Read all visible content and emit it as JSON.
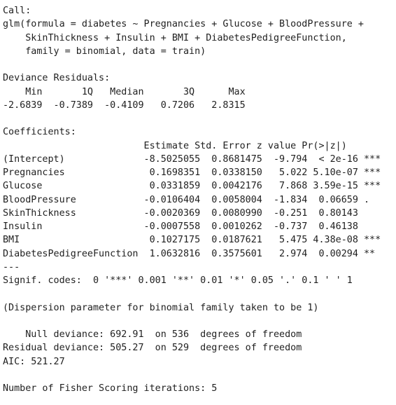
{
  "call": {
    "header": "Call:",
    "lines": [
      "glm(formula = diabetes ~ Pregnancies + Glucose + BloodPressure +",
      "    SkinThickness + Insulin + BMI + DiabetesPedigreeFunction,",
      "    family = binomial, data = train)"
    ]
  },
  "deviance_residuals": {
    "header": "Deviance Residuals:",
    "labels_line": "    Min       1Q   Median       3Q      Max  ",
    "values_line": "-2.6839  -0.7389  -0.4109   0.7206   2.8315  "
  },
  "coefficients": {
    "header": "Coefficients:",
    "column_header_line": "                         Estimate Std. Error z value Pr(>|z|)    ",
    "rows": [
      "(Intercept)              -8.5025055  0.8681475  -9.794  < 2e-16 ***",
      "Pregnancies               0.1698351  0.0338150   5.022 5.10e-07 ***",
      "Glucose                   0.0331859  0.0042176   7.868 3.59e-15 ***",
      "BloodPressure            -0.0106404  0.0058004  -1.834  0.06659 .  ",
      "SkinThickness            -0.0020369  0.0080990  -0.251  0.80143    ",
      "Insulin                  -0.0007558  0.0010262  -0.737  0.46138    ",
      "BMI                       0.1027175  0.0187621   5.475 4.38e-08 ***",
      "DiabetesPedigreeFunction  1.0632816  0.3575601   2.974  0.00294 ** "
    ],
    "separator": "---",
    "signif_codes": "Signif. codes:  0 '***' 0.001 '**' 0.01 '*' 0.05 '.' 0.1 ' ' 1"
  },
  "dispersion": "(Dispersion parameter for binomial family taken to be 1)",
  "deviance": {
    "null_line": "    Null deviance: 692.91  on 536  degrees of freedom",
    "residual_line": "Residual deviance: 505.27  on 529  degrees of freedom",
    "aic_line": "AIC: 521.27"
  },
  "fisher": "Number of Fisher Scoring iterations: 5"
}
